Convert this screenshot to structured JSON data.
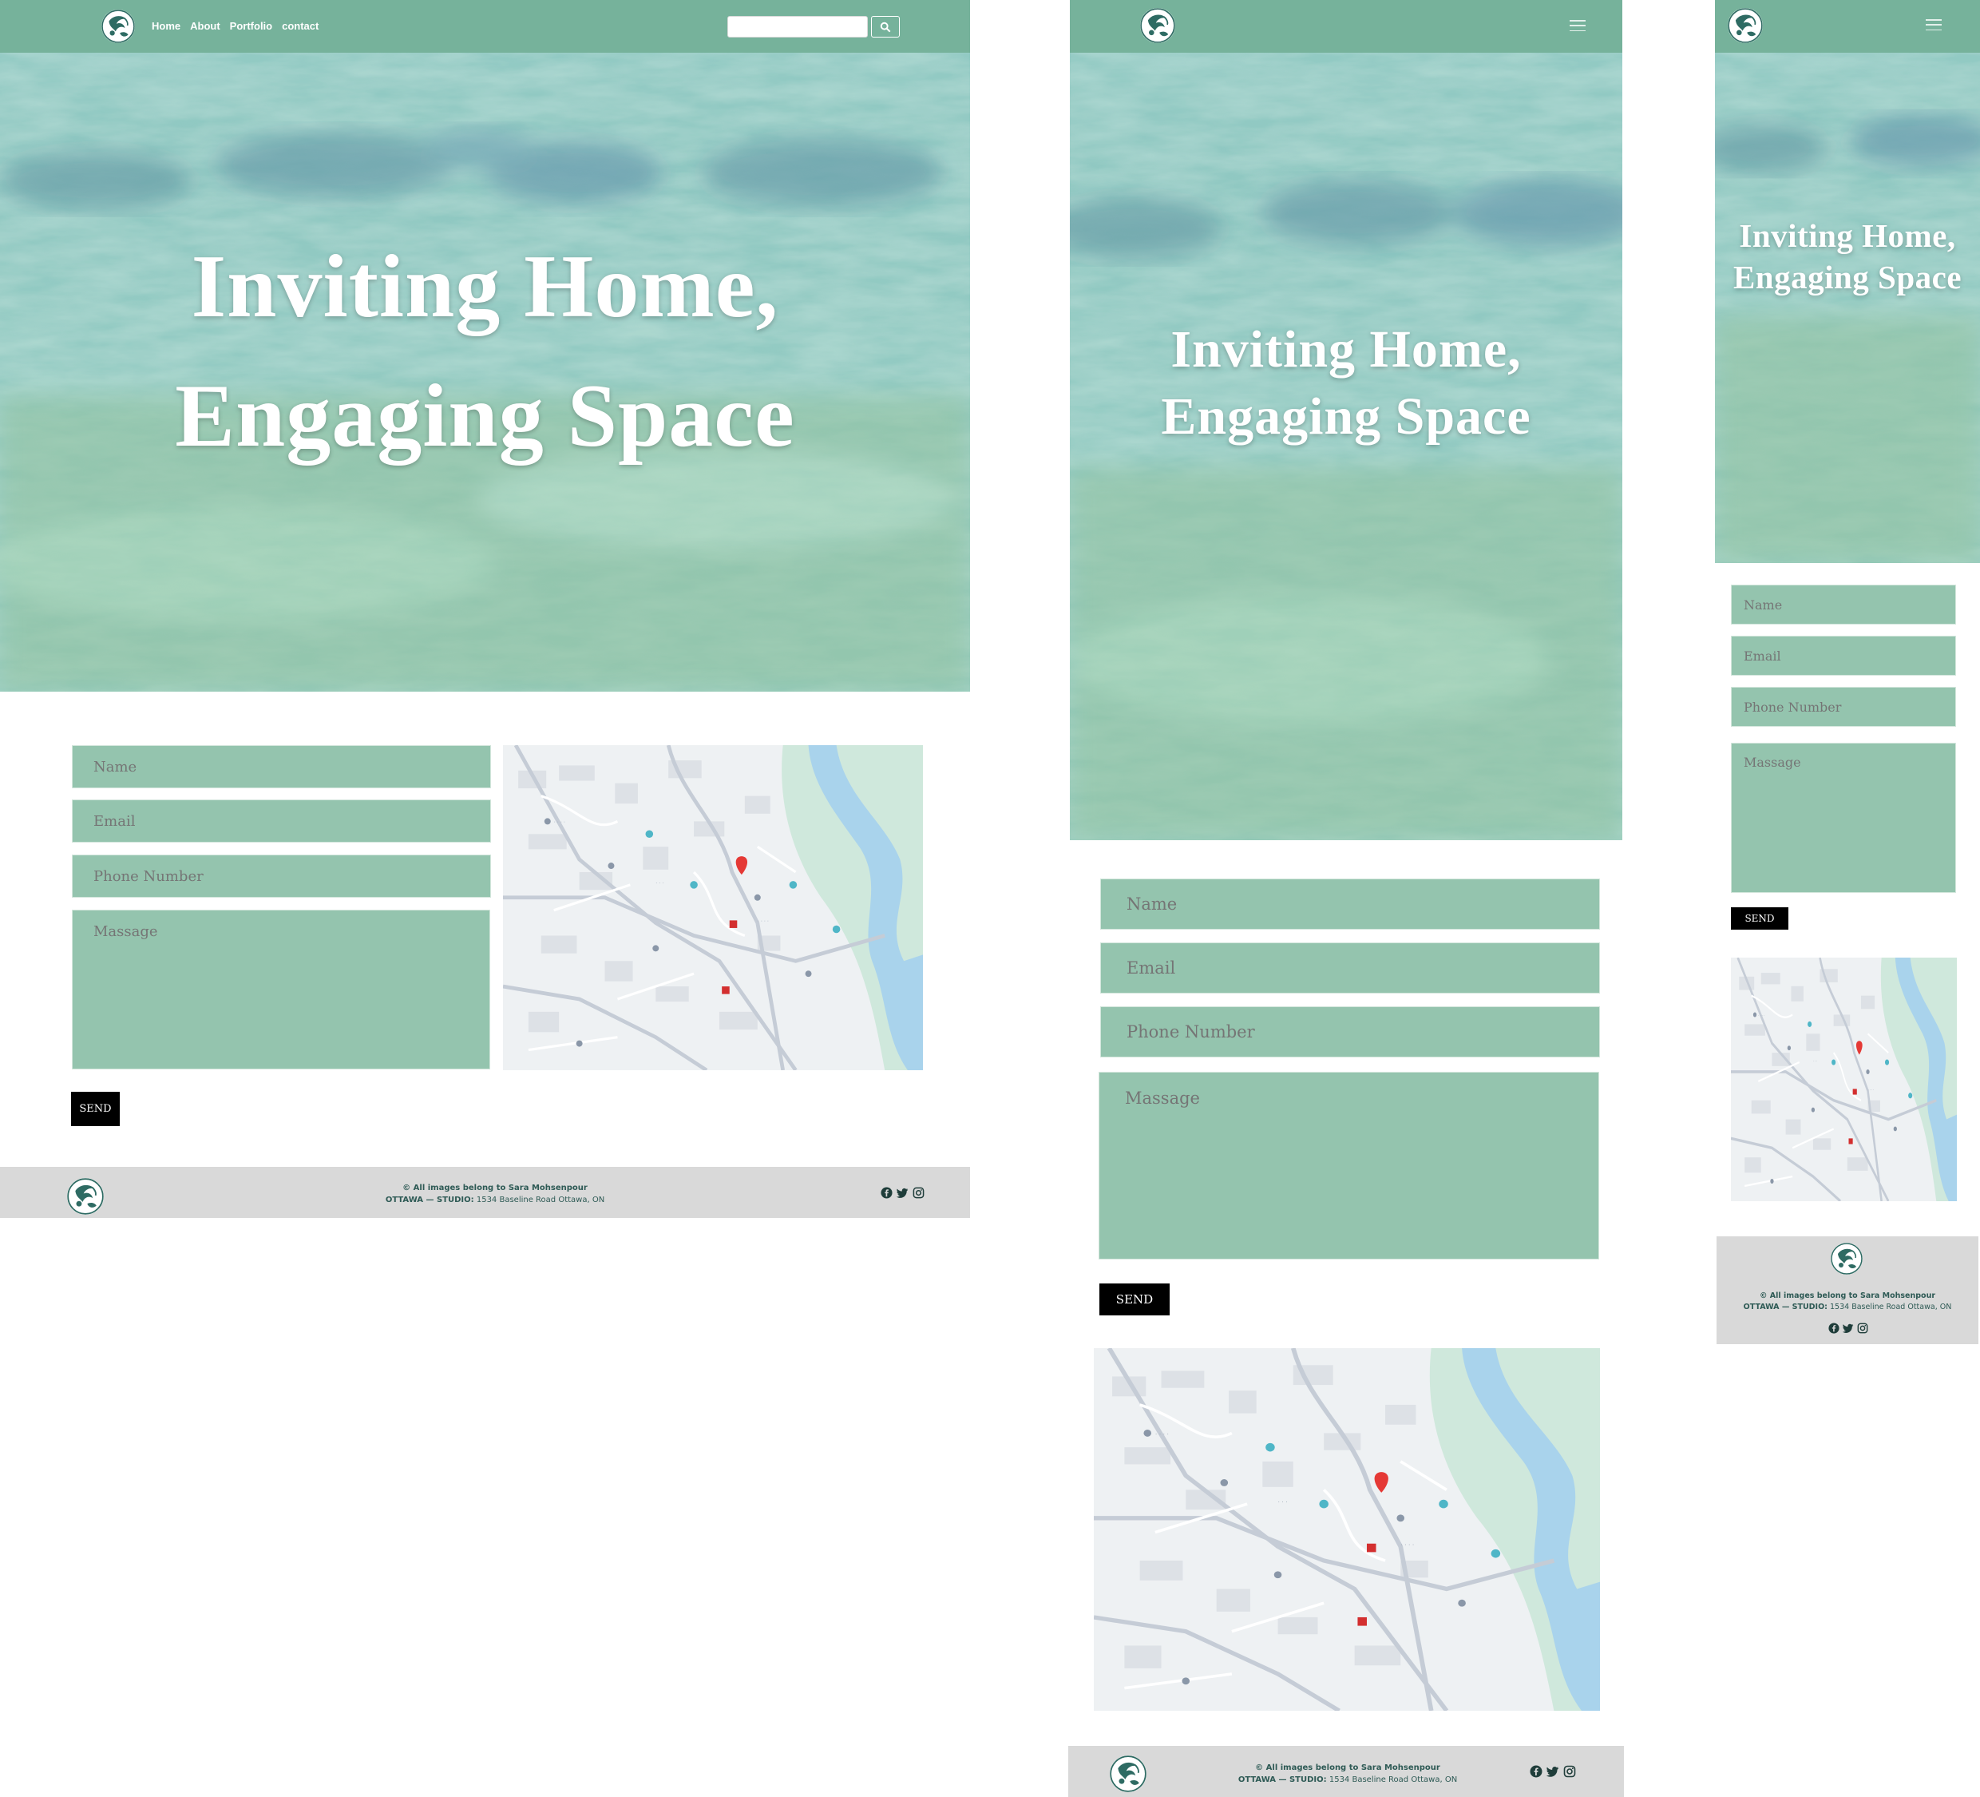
{
  "nav": {
    "links": [
      "Home",
      "About",
      "Portfolio",
      "contact"
    ],
    "search_placeholder": ""
  },
  "hero": {
    "title_line1": "Inviting Home,",
    "title_line2": "Engaging Space"
  },
  "form": {
    "name_placeholder": "Name",
    "email_placeholder": "Email",
    "phone_placeholder": "Phone Number",
    "message_placeholder": "Massage",
    "send_label": "SEND"
  },
  "footer": {
    "copyright": "© All images belong to Sara Mohsenpour",
    "studio_label": "OTTAWA — STUDIO:",
    "address": "1534 Baseline Road Ottawa, ON"
  },
  "colors": {
    "nav": "#76b29b",
    "field": "#94c4ae",
    "footer": "#d9d9d9",
    "footer_text": "#2e5a55",
    "send": "#000000"
  },
  "icons": [
    "logo-icon",
    "search-icon",
    "hamburger-menu-icon",
    "map-pin-icon",
    "facebook-icon",
    "twitter-icon",
    "instagram-icon"
  ]
}
